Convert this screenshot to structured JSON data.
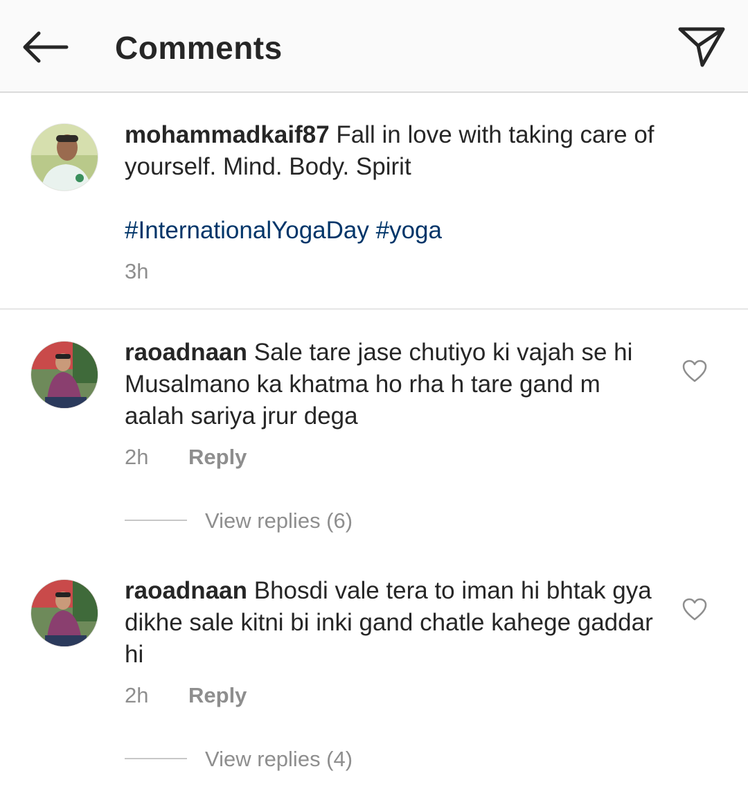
{
  "header": {
    "title": "Comments",
    "back_icon": "arrow-left-icon",
    "send_icon": "paper-plane-icon"
  },
  "post": {
    "username": "mohammadkaif87",
    "caption": "Fall in love with taking care of yourself. Mind. Body. Spirit",
    "hashtags": [
      "#InternationalYogaDay",
      "#yoga"
    ],
    "time": "3h"
  },
  "comments": [
    {
      "username": "raoadnaan",
      "text": "Sale tare jase chutiyo ki vajah se hi Musalmano ka khatma ho rha h tare gand m aalah sariya jrur dega",
      "time": "2h",
      "reply_label": "Reply",
      "view_replies": "View replies (6)"
    },
    {
      "username": "raoadnaan",
      "text": "Bhosdi vale tera to iman hi bhtak gya dikhe sale kitni bi inki gand chatle kahege gaddar hi",
      "time": "2h",
      "reply_label": "Reply",
      "view_replies": "View replies (4)"
    }
  ],
  "colors": {
    "text": "#262626",
    "secondary": "#8e8e8e",
    "hashtag": "#003569",
    "header_bg": "#fafafa"
  }
}
